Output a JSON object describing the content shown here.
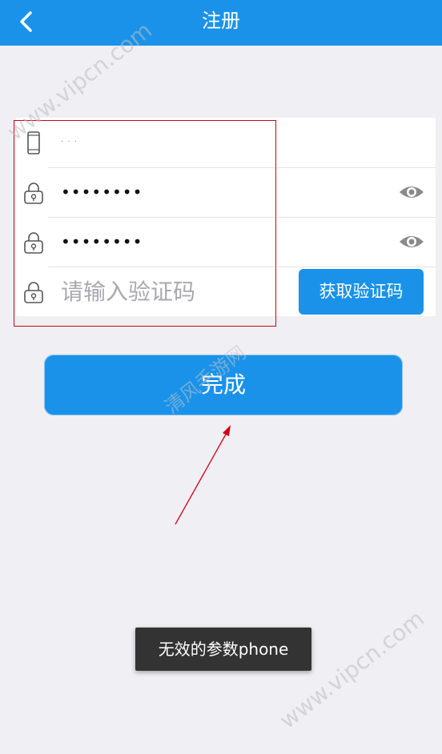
{
  "header": {
    "title": "注册",
    "back_icon": "chevron-left-icon",
    "bg_color": "#1a92e9"
  },
  "form": {
    "phone_value": "· · ·",
    "password_value": "••••••••",
    "confirm_password_value": "••••••••",
    "code_placeholder": "请输入验证码",
    "get_code_label": "获取验证码"
  },
  "submit_label": "完成",
  "toast": "无效的参数phone",
  "watermarks": {
    "top": "www.vipcn.com",
    "bottom": "www.vipcn.com",
    "middle": "清风手游网"
  }
}
